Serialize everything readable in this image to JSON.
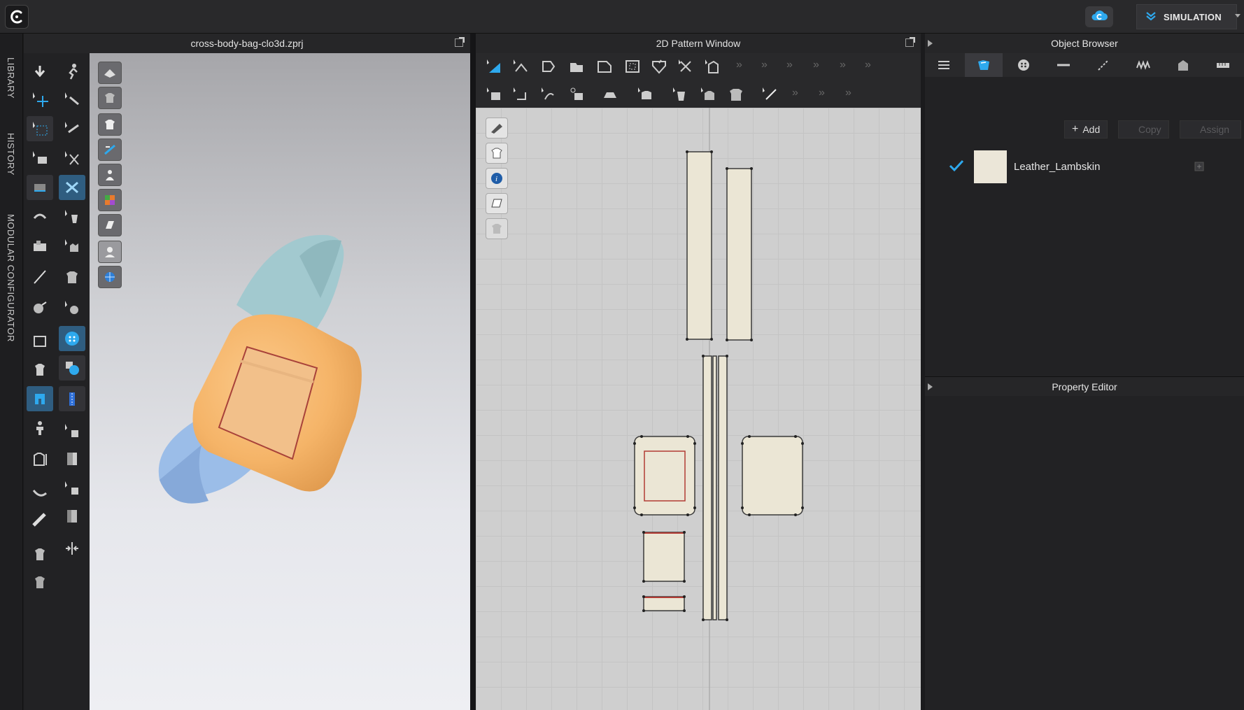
{
  "app": {
    "mode_label": "SIMULATION",
    "icons": {
      "logo": "clo-logo-icon",
      "cloud": "cloud-sync-icon",
      "mode": "chevron-double-down-icon"
    }
  },
  "left_tabs": [
    "LIBRARY",
    "HISTORY",
    "MODULAR CONFIGURATOR"
  ],
  "window_3d": {
    "title": "cross-body-bag-clo3d.zprj"
  },
  "window_2d": {
    "title": "2D Pattern Window"
  },
  "object_browser": {
    "title": "Object Browser",
    "tabs": [
      "list-icon",
      "fabric-icon",
      "button-icon",
      "buttonhole-icon",
      "topstitch-icon",
      "puckering-icon",
      "graphic-icon",
      "ruler-icon"
    ],
    "selected_tab": 1,
    "add_label": "Add",
    "copy_label": "Copy",
    "assign_label": "Assign",
    "materials": [
      {
        "name": "Leather_Lambskin",
        "swatch_color": "#ebe6d8",
        "checked": true
      }
    ]
  },
  "property_editor": {
    "title": "Property Editor"
  },
  "colors": {
    "accent": "#29a9f0",
    "fabric_cream": "#ebe6d5",
    "bag_orange": "#f5b468",
    "strap_blue": "#9bbde8",
    "strap_teal": "#9cc3c8"
  }
}
